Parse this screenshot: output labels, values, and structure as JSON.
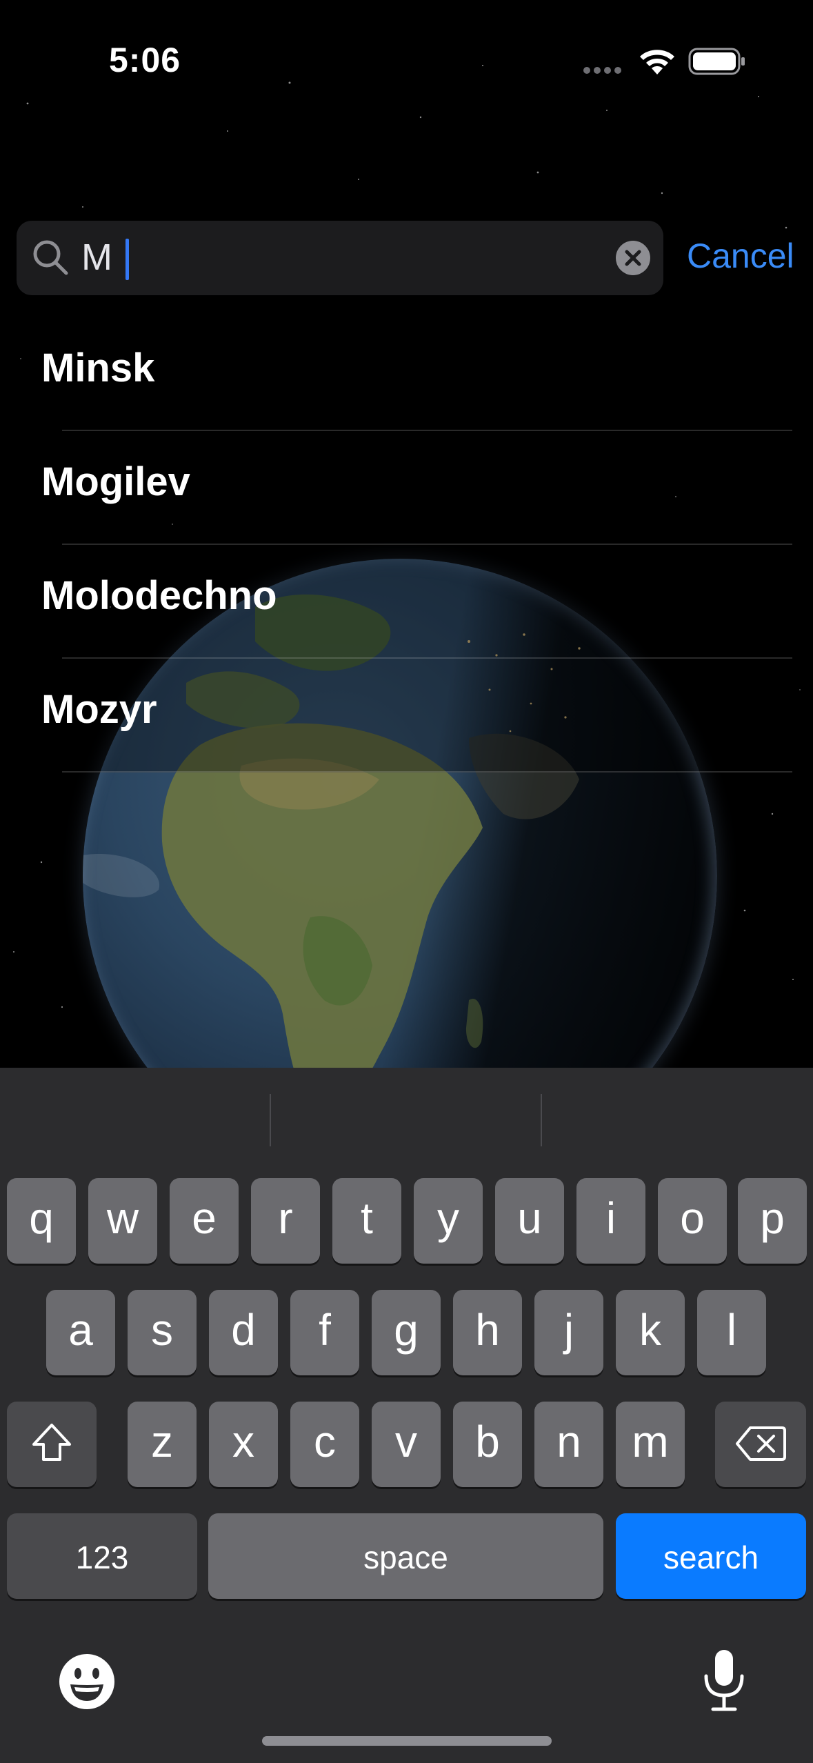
{
  "status_bar": {
    "time": "5:06",
    "icons": [
      "signal-dots-icon",
      "wifi-icon",
      "battery-icon"
    ]
  },
  "search": {
    "query": "M",
    "cancel_label": "Cancel",
    "accent_color": "#3a8bf7"
  },
  "results": [
    {
      "label": "Minsk"
    },
    {
      "label": "Mogilev"
    },
    {
      "label": "Molodechno"
    },
    {
      "label": "Mozyr"
    }
  ],
  "keyboard": {
    "row1": [
      "q",
      "w",
      "e",
      "r",
      "t",
      "y",
      "u",
      "i",
      "o",
      "p"
    ],
    "row2": [
      "a",
      "s",
      "d",
      "f",
      "g",
      "h",
      "j",
      "k",
      "l"
    ],
    "row3": [
      "z",
      "x",
      "c",
      "v",
      "b",
      "n",
      "m"
    ],
    "numbers_label": "123",
    "space_label": "space",
    "search_label": "search",
    "return_color": "#0a7bff",
    "icons": [
      "shift-icon",
      "backspace-icon",
      "emoji-icon",
      "microphone-icon"
    ]
  }
}
